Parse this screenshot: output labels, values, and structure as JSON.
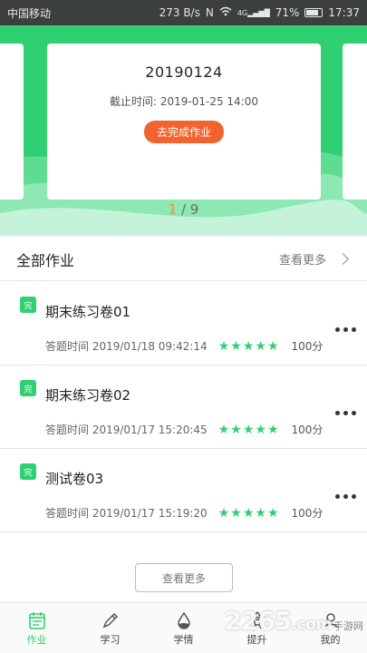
{
  "status_bar": {
    "carrier": "中国移动",
    "speed": "273 B/s",
    "nfc_icon": "nfc-icon",
    "wifi_icon": "wifi-icon",
    "signal_label": "4G",
    "battery": "71%",
    "time": "17:37"
  },
  "hero": {
    "card_title": "20190124",
    "deadline": "截止时间: 2019-01-25 14:00",
    "action_button": "去完成作业",
    "pager_current": "1",
    "pager_total": "/ 9",
    "colors": {
      "green": "#2fd071",
      "orange": "#f1642f"
    }
  },
  "section": {
    "title": "全部作业",
    "more": "查看更多"
  },
  "items": [
    {
      "badge": "完",
      "title": "期末练习卷01",
      "time": "答题时间 2019/01/18 09:42:14",
      "stars": 5,
      "score": "100分"
    },
    {
      "badge": "完",
      "title": "期末练习卷02",
      "time": "答题时间 2019/01/17 15:20:45",
      "stars": 5,
      "score": "100分"
    },
    {
      "badge": "完",
      "title": "测试卷03",
      "time": "答题时间 2019/01/17 15:19:20",
      "stars": 5,
      "score": "100分"
    }
  ],
  "load_more": "查看更多",
  "tabs": [
    {
      "label": "作业",
      "icon": "homework-icon",
      "active": true
    },
    {
      "label": "学习",
      "icon": "pencil-icon",
      "active": false
    },
    {
      "label": "学情",
      "icon": "drop-icon",
      "active": false
    },
    {
      "label": "提升",
      "icon": "rocket-icon",
      "active": false
    },
    {
      "label": "我的",
      "icon": "user-icon",
      "active": false
    }
  ],
  "watermark": {
    "brand": "2265",
    "suffix": ".com",
    "site": "手游网"
  }
}
